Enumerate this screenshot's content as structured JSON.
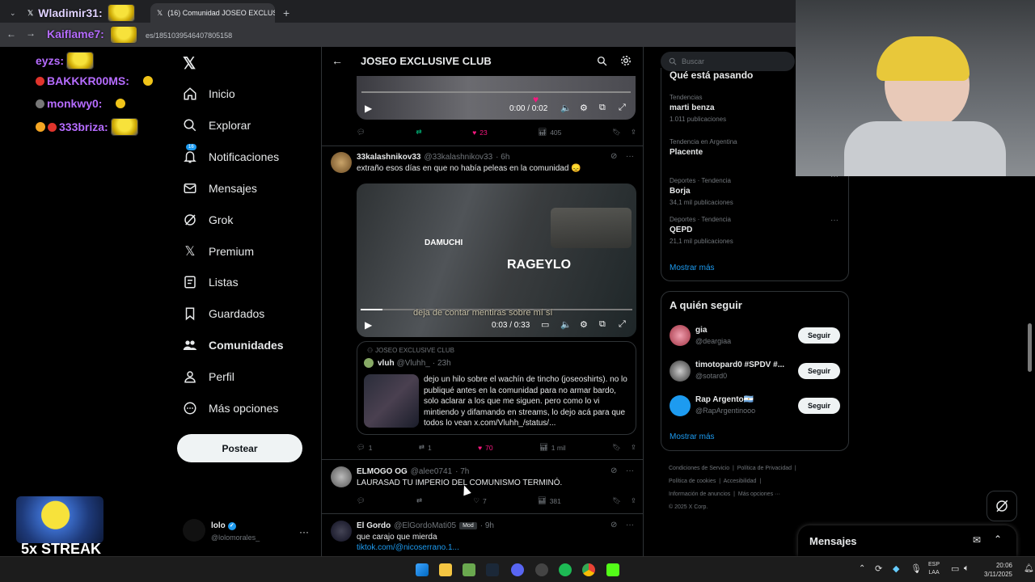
{
  "browser": {
    "tab1_label": "Wladimir31:",
    "tab2_label": "(16) Comunidad JOSEO EXCLUS",
    "new_tab": "+",
    "url": "es/1851039546407805158",
    "url_overlay_name": "Kaiflame7:"
  },
  "chat": [
    {
      "name": "eyzs:"
    },
    {
      "name": "BAKKKR00MS:"
    },
    {
      "name": "monkwy0:"
    },
    {
      "name": "333briza:"
    }
  ],
  "streak": {
    "label": "5x STREAK"
  },
  "nav": {
    "items": [
      {
        "label": "Inicio"
      },
      {
        "label": "Explorar"
      },
      {
        "label": "Notificaciones",
        "badge": "16"
      },
      {
        "label": "Mensajes"
      },
      {
        "label": "Grok"
      },
      {
        "label": "Premium"
      },
      {
        "label": "Listas"
      },
      {
        "label": "Guardados"
      },
      {
        "label": "Comunidades"
      },
      {
        "label": "Perfil"
      },
      {
        "label": "Más opciones"
      }
    ],
    "post_label": "Postear",
    "account_name": "lolo",
    "account_handle": "@lolomorales_",
    "more": "···"
  },
  "community": {
    "title": "JOSEO EXCLUSIVE CLUB",
    "video1": {
      "time": "0:00 / 0:02"
    },
    "tweet0_actions": {
      "replies": "",
      "retweets": "",
      "likes": "23",
      "views": "405"
    },
    "tweet1": {
      "name": "33kalashnikov33",
      "handle": "@33kalashnikov33",
      "time": "· 6h",
      "text": "extraño esos días en que no había peleas en la comunidad 😞",
      "video_caption": "deja de contar mentiras sobre mí sí",
      "video_label_left": "DAMUCHI",
      "video_label_right": "RAGEYLO",
      "video_time": "0:03 / 0:33",
      "quote_community": "JOSEO EXCLUSIVE CLUB",
      "quote_name": "vluh",
      "quote_handle": "@Vluhh_",
      "quote_time": "· 23h",
      "quote_text": "dejo un hilo sobre el wachín de tincho (joseoshirts). no lo publiqué antes en la comunidad para no armar bardo, solo aclarar a los que me siguen. pero como lo vi mintiendo y difamando en streams, lo dejo acá para que todos lo vean  x.com/Vluhh_/status/...",
      "replies": "1",
      "retweets": "1",
      "likes": "70",
      "views": "1 mil"
    },
    "tweet2": {
      "name": "ELMOGO OG",
      "handle": "@alee0741",
      "time": "· 7h",
      "text": "LAURASAD TU IMPERIO DEL COMUNISMO TERMINÓ.",
      "likes": "7",
      "views": "381"
    },
    "tweet3": {
      "name": "El Gordo",
      "handle": "@ElGordoMati05",
      "badge": "Mod",
      "time": "· 9h",
      "text": "que carajo que mierda",
      "link": "tiktok.com/@nicoserrano.1..."
    }
  },
  "right": {
    "search_placeholder": "Buscar",
    "trends_title": "Qué está pasando",
    "trends": [
      {
        "category": "Tendencias",
        "name": "marti benza",
        "count": "1.011 publicaciones"
      },
      {
        "category": "Tendencia en Argentina",
        "name": "Placente",
        "count": ""
      },
      {
        "category": "Deportes · Tendencia",
        "name": "Borja",
        "count": "34,1 mil publicaciones"
      },
      {
        "category": "Deportes · Tendencia",
        "name": "QEPD",
        "count": "21,1 mil publicaciones"
      }
    ],
    "show_more": "Mostrar más",
    "who_to_follow_title": "A quién seguir",
    "follow": [
      {
        "name": "gia",
        "handle": "@deargiaa"
      },
      {
        "name": "timotopard0 #SPDV #...",
        "handle": "@sotard0"
      },
      {
        "name": "Rap Argento🇦🇷",
        "handle": "@RapArgentinooo"
      }
    ],
    "follow_label": "Seguir",
    "show_more2": "Mostrar más",
    "footer": {
      "line1a": "Condiciones de Servicio",
      "line1b": "Política de Privacidad",
      "line2a": "Política de cookies",
      "line2b": "Accesibilidad",
      "line3a": "Información de anuncios",
      "line3b": "Más opciones ···",
      "copyright": "© 2025 X Corp."
    }
  },
  "messages": {
    "label": "Mensajes"
  },
  "taskbar": {
    "lang1": "ESP",
    "lang2": "LAA",
    "time": "20:06",
    "date": "3/11/2025"
  }
}
